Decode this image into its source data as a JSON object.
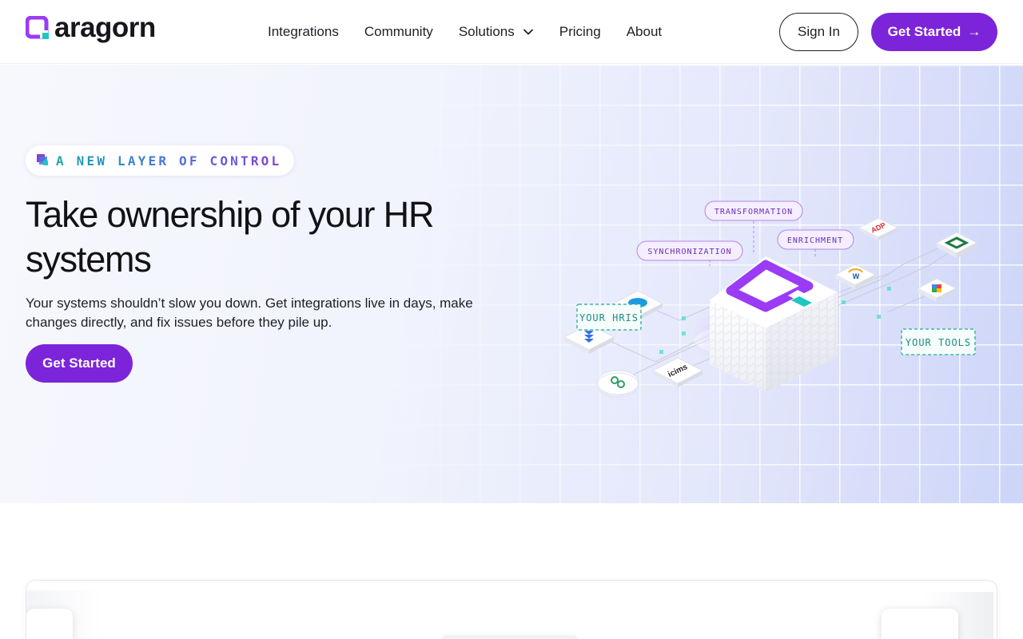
{
  "brand": {
    "name": "aragorn",
    "accent": "#7c24d9",
    "mark_colors": [
      "#9b3bf5",
      "#1ec8c0"
    ]
  },
  "nav": {
    "items": [
      {
        "label": "Integrations"
      },
      {
        "label": "Community"
      },
      {
        "label": "Solutions",
        "has_dropdown": true
      },
      {
        "label": "Pricing"
      },
      {
        "label": "About"
      }
    ],
    "sign_in": "Sign In",
    "get_started": "Get Started",
    "get_started_icon": "arrow-right-icon"
  },
  "hero": {
    "eyebrow": "A NEW LAYER OF CONTROL",
    "title": "Take ownership of your HR systems",
    "subtitle": "Your systems shouldn’t slow you down. Get integrations live in days, make changes directly, and fix issues before they pile up.",
    "cta": "Get Started"
  },
  "diagram": {
    "labels": {
      "transformation": "TRANSFORMATION",
      "synchronization": "SYNCHRONIZATION",
      "enrichment": "ENRICHMENT",
      "your_hris": "YOUR HRIS",
      "your_tools": "YOUR TOOLS"
    },
    "left_tiles": [
      "salesforce-icon",
      "stack-icon",
      "greenhouse-icon",
      "icims-icon"
    ],
    "left_tile_text": {
      "icims": "icims"
    },
    "right_tiles": [
      "adp-icon",
      "workday-icon",
      "gsuite-icon",
      "box-icon"
    ],
    "right_tile_text": {
      "adp": "ADP"
    }
  }
}
